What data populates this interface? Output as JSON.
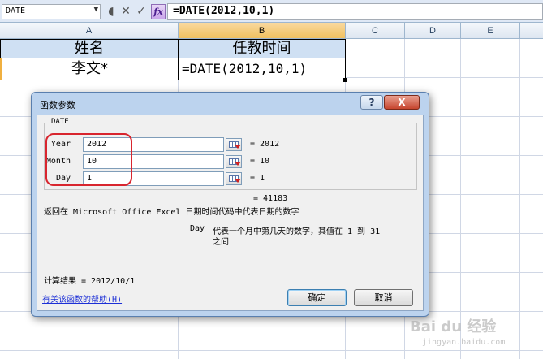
{
  "formula_bar": {
    "name_box": "DATE",
    "cancel_symbol": "✕",
    "enter_symbol": "✓",
    "fx_label": "fx",
    "formula": "=DATE(2012,10,1)"
  },
  "columns": [
    "A",
    "B",
    "C",
    "D",
    "E"
  ],
  "cells": {
    "a1": "姓名",
    "b1": "任教时间",
    "a2": "李文*",
    "b2": "=DATE(2012,10,1)"
  },
  "dialog": {
    "title": "函数参数",
    "help_button": "?",
    "close_button": "X",
    "function_name": "DATE",
    "args": [
      {
        "label": "Year",
        "value": "2012",
        "result": "= 2012"
      },
      {
        "label": "Month",
        "value": "10",
        "result": "= 10"
      },
      {
        "label": "Day",
        "value": "1",
        "result": "= 1"
      }
    ],
    "total_result": "= 41183",
    "description": "返回在 Microsoft Office Excel 日期时间代码中代表日期的数字",
    "arg_help_name": "Day",
    "arg_help_line1": "代表一个月中第几天的数字，其值在 1 到 31",
    "arg_help_line2": "之间",
    "calc_result": "计算结果 = 2012/10/1",
    "help_link": "有关该函数的帮助(H)",
    "ok_button": "确定",
    "cancel_button": "取消"
  },
  "watermark": {
    "main": "Bai du 经验",
    "sub": "jingyan.baidu.com"
  },
  "colors": {
    "header_fill": "#cfe0f3",
    "selected_column": "#f1c15f",
    "annotation_red": "#d8252e",
    "link_blue": "#1c2fd6"
  }
}
